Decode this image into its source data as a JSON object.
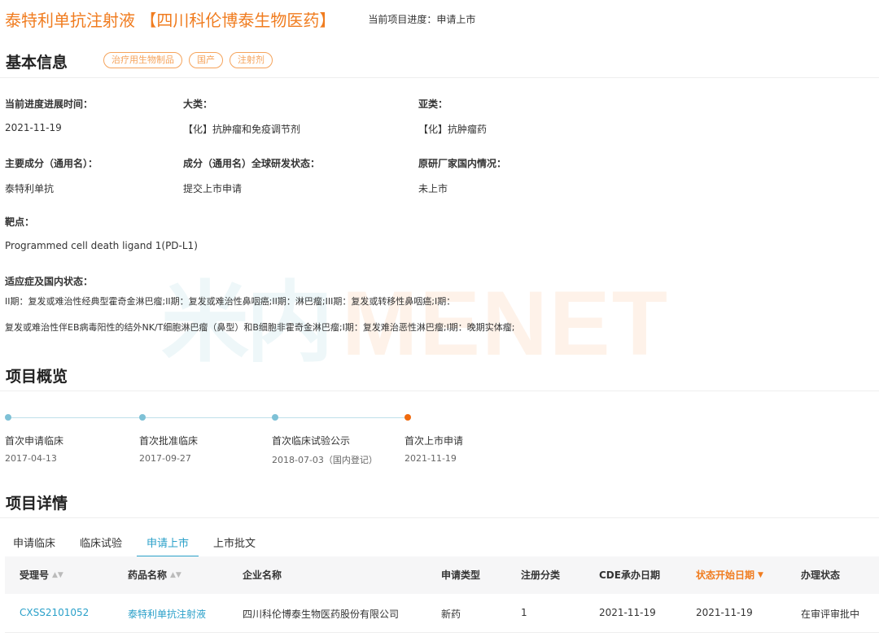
{
  "header": {
    "drug_title": "泰特利单抗注射液 【四川科伦博泰生物医药】",
    "progress_label": "当前项目进度：申请上市"
  },
  "watermark": {
    "cn": "米内",
    "en": "MENET"
  },
  "basic_info": {
    "title": "基本信息",
    "tags": [
      "治疗用生物制品",
      "国产",
      "注射剂"
    ],
    "fields": {
      "progress_time": {
        "label": "当前进度进展时间：",
        "value": "2021-11-19"
      },
      "category": {
        "label": "大类：",
        "value": "【化】抗肿瘤和免疫调节剂"
      },
      "subcategory": {
        "label": "亚类：",
        "value": "【化】抗肿瘤药"
      },
      "main_ingredient": {
        "label": "主要成分（通用名）：",
        "value": "泰特利单抗"
      },
      "global_status": {
        "label": "成分（通用名）全球研发状态：",
        "value": "提交上市申请"
      },
      "originator_domestic": {
        "label": "原研厂家国内情况：",
        "value": "未上市"
      },
      "target": {
        "label": "靶点：",
        "value": "Programmed cell death ligand 1(PD-L1)"
      },
      "indications": {
        "label": "适应症及国内状态：",
        "line1": "II期：复发或难治性经典型霍奇金淋巴瘤;II期：复发或难治性鼻咽癌;II期：淋巴瘤;III期：复发或转移性鼻咽癌;I期：",
        "line2": "复发或难治性伴EB病毒阳性的结外NK/T细胞淋巴瘤（鼻型）和B细胞非霍奇金淋巴瘤;I期：复发难治恶性淋巴瘤;I期：晚期实体瘤;"
      }
    }
  },
  "overview": {
    "title": "项目概览",
    "timeline": [
      {
        "title": "首次申请临床",
        "date": "2017-04-13"
      },
      {
        "title": "首次批准临床",
        "date": "2017-09-27"
      },
      {
        "title": "首次临床试验公示",
        "date": "2018-07-03（国内登记）"
      },
      {
        "title": "首次上市申请",
        "date": "2021-11-19"
      }
    ]
  },
  "details": {
    "title": "项目详情",
    "tabs": [
      "申请临床",
      "临床试验",
      "申请上市",
      "上市批文"
    ],
    "active_tab": "申请上市",
    "columns": [
      "受理号",
      "药品名称",
      "企业名称",
      "申请类型",
      "注册分类",
      "CDE承办日期",
      "状态开始日期",
      "办理状态"
    ],
    "rows": [
      {
        "accept_no": "CXSS2101052",
        "drug_name": "泰特利单抗注射液",
        "company": "四川科伦博泰生物医药股份有限公司",
        "apply_type": "新药",
        "reg_class": "1",
        "cde_date": "2021-11-19",
        "status_date": "2021-11-19",
        "status": "在审评审批中"
      }
    ]
  },
  "colors": {
    "accent_orange": "#f07c1f",
    "link_blue": "#2aa0c9",
    "timeline_dot": "#7ec1d6",
    "timeline_active": "#f06a0e",
    "tag_border": "#f5a35b"
  }
}
